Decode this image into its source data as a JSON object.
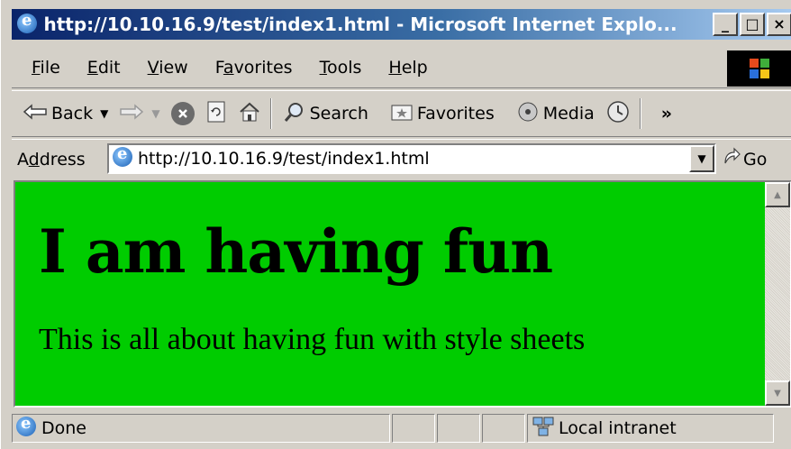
{
  "window": {
    "title": "http://10.10.16.9/test/index1.html - Microsoft Internet Explo...",
    "controls": {
      "minimize": "_",
      "maximize": "□",
      "close": "×"
    }
  },
  "menu": {
    "items": [
      {
        "pre": "",
        "key": "F",
        "post": "ile"
      },
      {
        "pre": "",
        "key": "E",
        "post": "dit"
      },
      {
        "pre": "",
        "key": "V",
        "post": "iew"
      },
      {
        "pre": "F",
        "key": "a",
        "post": "vorites"
      },
      {
        "pre": "",
        "key": "T",
        "post": "ools"
      },
      {
        "pre": "",
        "key": "H",
        "post": "elp"
      }
    ]
  },
  "toolbar": {
    "back": "Back",
    "search": "Search",
    "favorites": "Favorites",
    "media": "Media",
    "more": "»"
  },
  "address": {
    "label_pre": "A",
    "label_key": "d",
    "label_post": "dress",
    "url": "http://10.10.16.9/test/index1.html",
    "go": "Go"
  },
  "page": {
    "heading": "I am having fun",
    "paragraph": "This is all about having fun with style sheets",
    "background": "#00cc00"
  },
  "status": {
    "text": "Done",
    "zone": "Local intranet"
  },
  "icons": [
    "ie-icon",
    "minimize-icon",
    "maximize-icon",
    "close-icon",
    "windows-logo-icon",
    "back-arrow-icon",
    "forward-arrow-icon",
    "stop-icon",
    "refresh-icon",
    "home-icon",
    "search-icon",
    "favorites-icon",
    "media-icon",
    "history-icon",
    "go-arrow-icon",
    "local-intranet-icon"
  ]
}
